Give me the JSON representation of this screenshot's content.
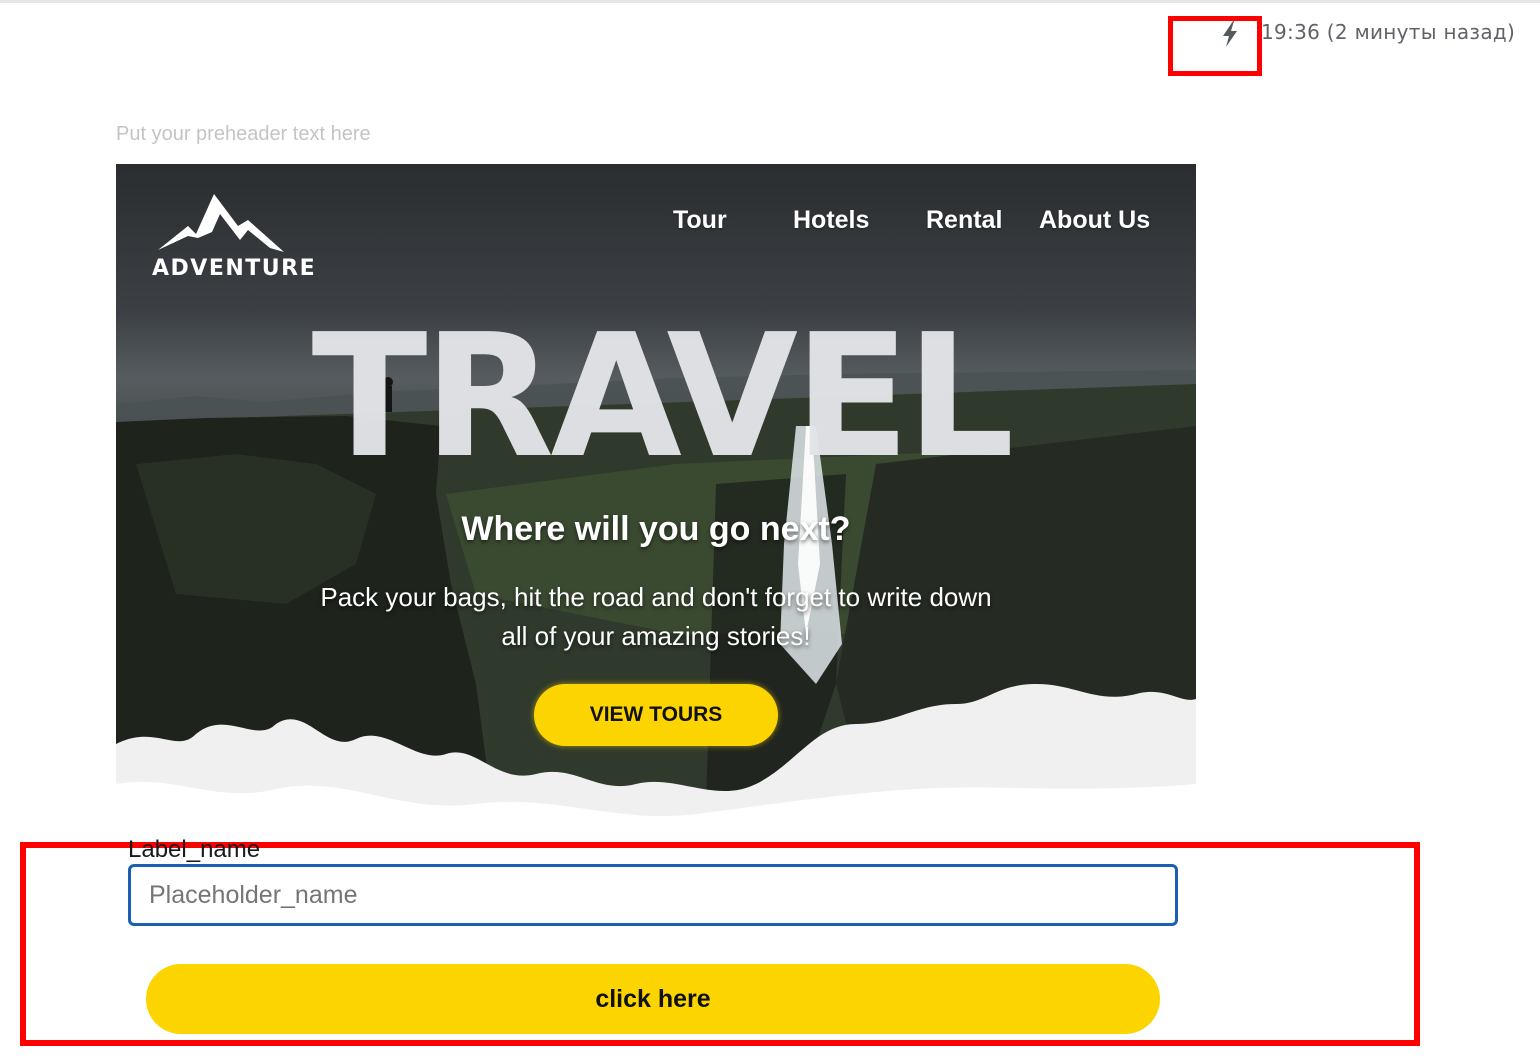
{
  "header": {
    "timestamp": "19:36 (2 минуты назад)",
    "icon": "lightning-icon",
    "highlight_color": "#ff0000"
  },
  "email": {
    "preheader": "Put your preheader text here",
    "brand": "ADVENTURE",
    "nav": [
      "Tour",
      "Hotels",
      "Rental",
      "About Us"
    ],
    "hero": {
      "title": "TRAVEL",
      "subtitle": "Where will you go next?",
      "body": "Pack your bags, hit the road and don't forget to write down all of your amazing stories!",
      "button_label": "VIEW TOURS"
    }
  },
  "form": {
    "label": "Label_name",
    "placeholder": "Placeholder_name",
    "value": "",
    "submit_label": "click here"
  },
  "colors": {
    "accent": "#fcd400",
    "input_border": "#1a5fb4",
    "preheader": "#c4c4c4",
    "timestamp": "#5f6368"
  }
}
